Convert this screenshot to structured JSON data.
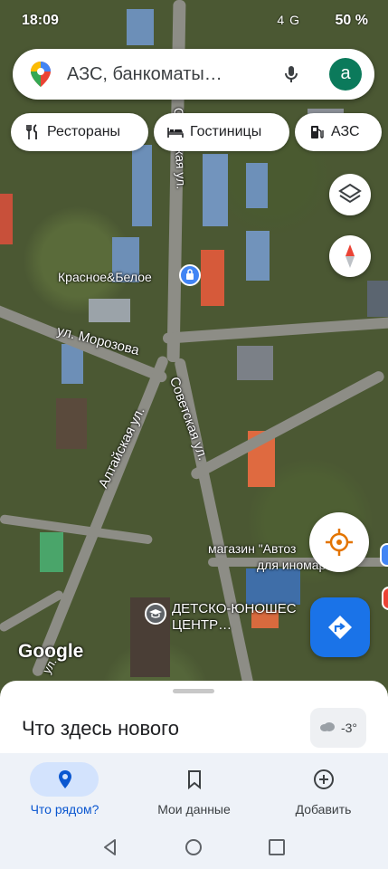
{
  "status_bar": {
    "time": "18:09",
    "battery": "50 %",
    "network": "4G"
  },
  "search": {
    "placeholder": "АЗС, банкоматы…",
    "avatar_letter": "a"
  },
  "chips": [
    {
      "label": "Рестораны",
      "icon": "fork-knife-icon"
    },
    {
      "label": "Гостиницы",
      "icon": "bed-icon"
    },
    {
      "label": "АЗС",
      "icon": "gas-pump-icon"
    }
  ],
  "map_labels": {
    "poi_shop": "Красное&Белое",
    "street_morozova": "ул. Морозова",
    "street_altayskaya": "Алтайская ул.",
    "street_sovetskaya_bottom": "Советская ул.",
    "street_sovetskaya_top": "Советская ул.",
    "poi_school": "ДЕТСКО-ЮНОШЕС",
    "poi_school_2": "ЦЕНТР…",
    "poi_auto": "магазин \"Автоз",
    "poi_auto_2": "для иномарок\"",
    "street_bottom_left": "ул."
  },
  "google_logo": "Google",
  "sheet": {
    "title": "Что здесь нового",
    "weather": "-3°"
  },
  "bottom_nav": [
    {
      "label": "Что рядом?",
      "icon": "location-pin-icon",
      "active": true
    },
    {
      "label": "Мои данные",
      "icon": "bookmark-icon",
      "active": false
    },
    {
      "label": "Добавить",
      "icon": "add-circle-icon",
      "active": false
    }
  ],
  "colors": {
    "accent": "#1a73e8",
    "directions_fab": "#1a73e8",
    "poi_red": "#ea4335",
    "active_pill": "#d3e3fd"
  }
}
